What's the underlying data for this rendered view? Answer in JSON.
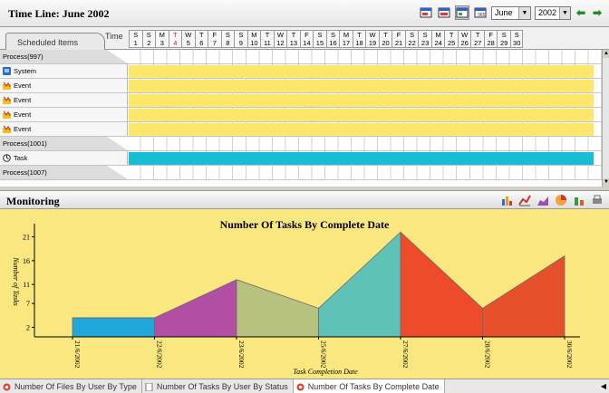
{
  "timeline": {
    "title": "Time Line: June 2002",
    "month": "June",
    "year": "2002",
    "scheduled_tab": "Scheduled Items",
    "time_label": "Time",
    "days": [
      {
        "w": "S",
        "d": "1"
      },
      {
        "w": "S",
        "d": "2"
      },
      {
        "w": "M",
        "d": "3"
      },
      {
        "w": "T",
        "d": "4",
        "today": true
      },
      {
        "w": "W",
        "d": "5"
      },
      {
        "w": "T",
        "d": "6"
      },
      {
        "w": "F",
        "d": "7"
      },
      {
        "w": "S",
        "d": "8"
      },
      {
        "w": "S",
        "d": "9"
      },
      {
        "w": "M",
        "d": "10"
      },
      {
        "w": "T",
        "d": "11"
      },
      {
        "w": "W",
        "d": "12"
      },
      {
        "w": "T",
        "d": "13"
      },
      {
        "w": "F",
        "d": "14"
      },
      {
        "w": "S",
        "d": "15"
      },
      {
        "w": "S",
        "d": "16"
      },
      {
        "w": "M",
        "d": "17"
      },
      {
        "w": "T",
        "d": "18"
      },
      {
        "w": "W",
        "d": "19"
      },
      {
        "w": "T",
        "d": "20"
      },
      {
        "w": "F",
        "d": "21"
      },
      {
        "w": "S",
        "d": "22"
      },
      {
        "w": "S",
        "d": "23"
      },
      {
        "w": "M",
        "d": "24"
      },
      {
        "w": "T",
        "d": "25"
      },
      {
        "w": "W",
        "d": "26"
      },
      {
        "w": "T",
        "d": "27"
      },
      {
        "w": "F",
        "d": "28"
      },
      {
        "w": "S",
        "d": "29"
      },
      {
        "w": "S",
        "d": "30"
      }
    ],
    "rows": [
      {
        "label": "Process(997)",
        "kind": "group",
        "icon": ""
      },
      {
        "label": "System",
        "kind": "item",
        "icon": "system-icon",
        "bar": "yellow"
      },
      {
        "label": "Event",
        "kind": "item",
        "icon": "event-icon",
        "bar": "yellow"
      },
      {
        "label": "Event",
        "kind": "item",
        "icon": "event-icon",
        "bar": "yellow"
      },
      {
        "label": "Event",
        "kind": "item",
        "icon": "event-icon",
        "bar": "yellow"
      },
      {
        "label": "Event",
        "kind": "item",
        "icon": "event-icon",
        "bar": "yellow"
      },
      {
        "label": "Process(1001)",
        "kind": "group",
        "icon": ""
      },
      {
        "label": "Task",
        "kind": "item",
        "icon": "task-icon",
        "bar": "cyan"
      },
      {
        "label": "Process(1007)",
        "kind": "group",
        "icon": ""
      }
    ]
  },
  "monitoring": {
    "title": "Monitoring"
  },
  "chart_data": {
    "type": "area",
    "title": "Number Of Tasks By Complete Date",
    "xlabel": "Task Completion Date",
    "ylabel": "Number of Tasks",
    "categories": [
      "21/6/2002",
      "22/6/2002",
      "23/6/2002",
      "25/6/2002",
      "27/6/2002",
      "28/6/2002",
      "30/6/2002"
    ],
    "values": [
      4,
      4,
      12,
      6,
      22,
      6,
      17
    ],
    "yticks": [
      2,
      7,
      11,
      16,
      21
    ],
    "ylim": [
      0,
      23
    ],
    "segment_colors": [
      "#1fa8d9",
      "#b24ea4",
      "#b6c27e",
      "#5ec2b7",
      "#ee4b2b",
      "#e6502a"
    ]
  },
  "tabs": [
    {
      "label": "Number Of Files By User By Type",
      "icon": "chart-tab-icon",
      "active": false
    },
    {
      "label": "Number Of Tasks By User By Status",
      "icon": "doc-tab-icon",
      "active": false
    },
    {
      "label": "Number Of Tasks By Complete Date",
      "icon": "chart-tab-icon",
      "active": true
    }
  ]
}
